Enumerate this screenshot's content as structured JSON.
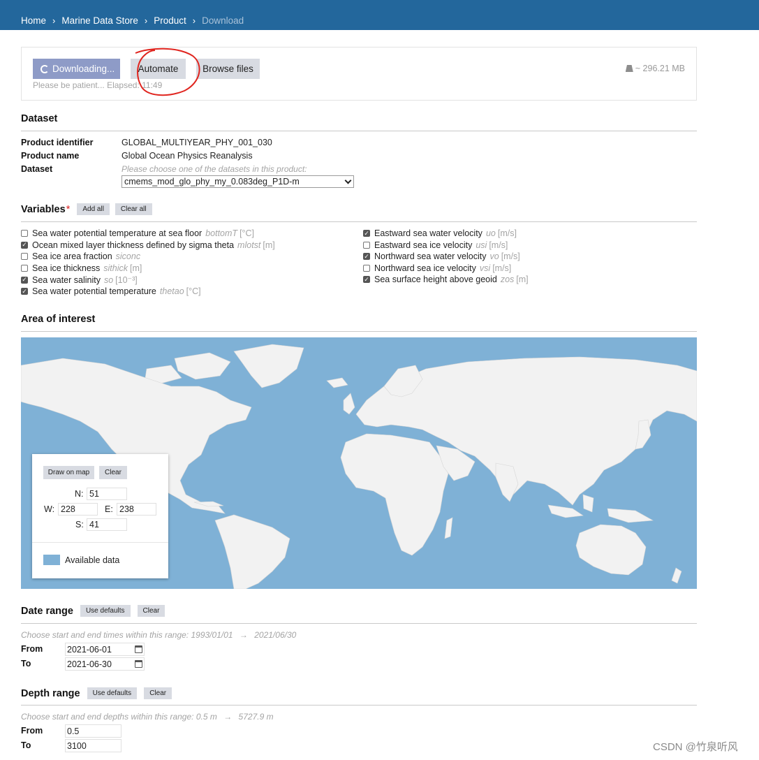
{
  "breadcrumb": {
    "home": "Home",
    "store": "Marine Data Store",
    "product": "Product",
    "current": "Download"
  },
  "download": {
    "downloading_label": "Downloading...",
    "automate_label": "Automate",
    "browse_label": "Browse files",
    "patient_text": "Please be patient... Elapsed:",
    "elapsed": "11:49",
    "size": "~ 296.21 MB"
  },
  "dataset": {
    "heading": "Dataset",
    "product_id_label": "Product identifier",
    "product_id": "GLOBAL_MULTIYEAR_PHY_001_030",
    "product_name_label": "Product name",
    "product_name": "Global Ocean Physics Reanalysis",
    "dataset_label": "Dataset",
    "dataset_hint": "Please choose one of the datasets in this product:",
    "dataset_selected": "cmems_mod_glo_phy_my_0.083deg_P1D-m"
  },
  "variables": {
    "heading": "Variables",
    "required_mark": "*",
    "add_all": "Add all",
    "clear_all": "Clear all",
    "left": [
      {
        "label": "Sea water potential temperature at sea floor",
        "code": "bottomT",
        "unit": "[°C]",
        "checked": false
      },
      {
        "label": "Ocean mixed layer thickness defined by sigma theta",
        "code": "mlotst",
        "unit": "[m]",
        "checked": true
      },
      {
        "label": "Sea ice area fraction",
        "code": "siconc",
        "unit": "",
        "checked": false
      },
      {
        "label": "Sea ice thickness",
        "code": "sithick",
        "unit": "[m]",
        "checked": false
      },
      {
        "label": "Sea water salinity",
        "code": "so",
        "unit": "[10⁻³]",
        "checked": true
      },
      {
        "label": "Sea water potential temperature",
        "code": "thetao",
        "unit": "[°C]",
        "checked": true
      }
    ],
    "right": [
      {
        "label": "Eastward sea water velocity",
        "code": "uo",
        "unit": "[m/s]",
        "checked": true
      },
      {
        "label": "Eastward sea ice velocity",
        "code": "usi",
        "unit": "[m/s]",
        "checked": false
      },
      {
        "label": "Northward sea water velocity",
        "code": "vo",
        "unit": "[m/s]",
        "checked": true
      },
      {
        "label": "Northward sea ice velocity",
        "code": "vsi",
        "unit": "[m/s]",
        "checked": false
      },
      {
        "label": "Sea surface height above geoid",
        "code": "zos",
        "unit": "[m]",
        "checked": true
      }
    ]
  },
  "area": {
    "heading": "Area of interest",
    "draw_label": "Draw on map",
    "clear_label": "Clear",
    "n_label": "N:",
    "n_value": "51",
    "w_label": "W:",
    "w_value": "228",
    "e_label": "E:",
    "e_value": "238",
    "s_label": "S:",
    "s_value": "41",
    "legend_label": "Available data",
    "ocean_color": "#7fb1d6",
    "land_color": "#f2f2f2"
  },
  "date_range": {
    "heading": "Date range",
    "use_defaults": "Use defaults",
    "clear": "Clear",
    "hint_prefix": "Choose start and end times within this range:",
    "min": "1993/01/01",
    "arrow": "→",
    "max": "2021/06/30",
    "from_label": "From",
    "from_value": "2021-06-01",
    "to_label": "To",
    "to_value": "2021-06-30"
  },
  "depth_range": {
    "heading": "Depth range",
    "use_defaults": "Use defaults",
    "clear": "Clear",
    "hint_prefix": "Choose start and end depths within this range:",
    "min": "0.5 m",
    "arrow": "→",
    "max": "5727.9 m",
    "from_label": "From",
    "from_value": "0.5",
    "to_label": "To",
    "to_value": "3100"
  },
  "watermark": "CSDN @竹泉听风",
  "colors": {
    "topbar": "#23679c",
    "button_primary": "#8e9bc7",
    "button_grey": "#d8dbe2",
    "annotation_red": "#e0251f"
  }
}
